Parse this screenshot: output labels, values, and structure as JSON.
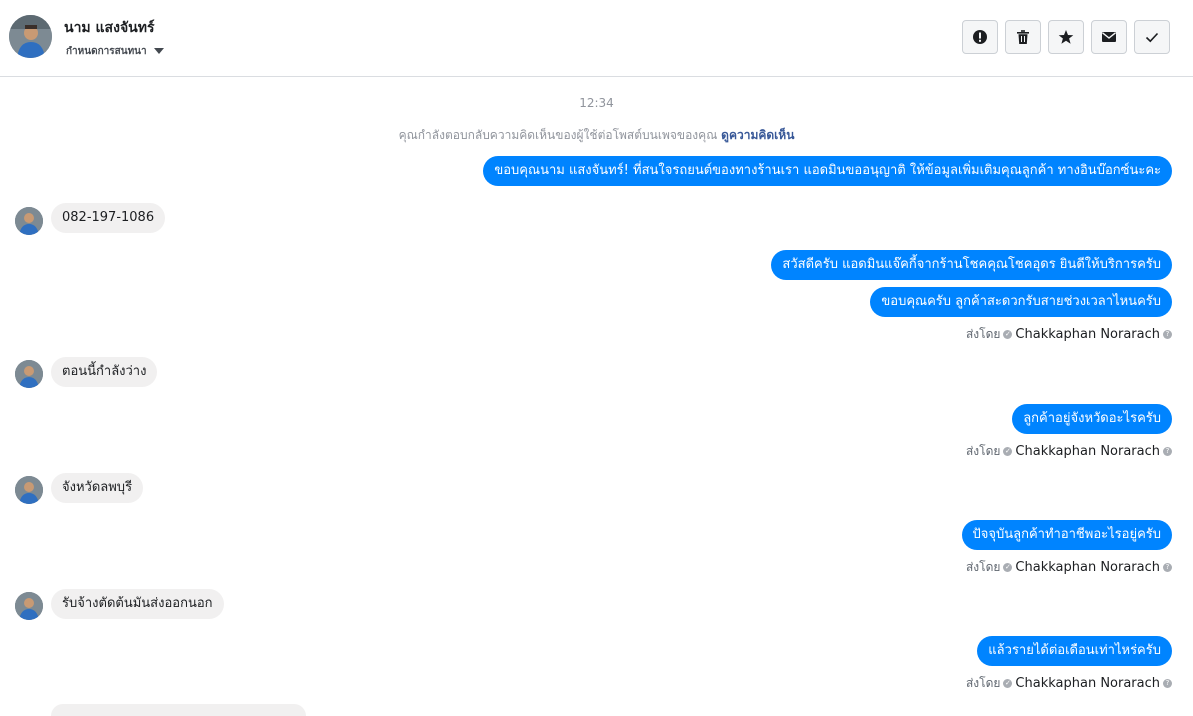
{
  "header": {
    "name": "นาม แสงจันทร์",
    "subtitle": "กำหนดการสนทนา",
    "buttons": [
      {
        "name": "report-button",
        "icon": "exclamation-icon"
      },
      {
        "name": "delete-button",
        "icon": "trash-icon"
      },
      {
        "name": "star-button",
        "icon": "star-icon"
      },
      {
        "name": "mark-unread-button",
        "icon": "envelope-icon"
      },
      {
        "name": "mark-done-button",
        "icon": "check-icon"
      }
    ]
  },
  "conversation": {
    "timestamp": "12:34",
    "reply_note": "คุณกำลังตอบกลับความคิดเห็นของผู้ใช้ต่อโพสต์บนเพจของคุณ",
    "reply_link": "ดูความคิดเห็น",
    "sent_by_label": "ส่งโดย",
    "agent_name": "Chakkaphan Norarach",
    "messages": [
      {
        "from": "page",
        "text": "ขอบคุณนาม แสงจันทร์! ที่สนใจรถยนต์ของทางร้านเรา แอดมินขออนุญาติ ให้ข้อมูลเพิ่มเติมคุณลูกค้า ทางอินบ๊อกซ์นะคะ"
      },
      {
        "from": "user",
        "text": "082-197-1086"
      },
      {
        "from": "page",
        "text": "สวัสดีครับ แอดมินแจ๊คกี้จากร้านโชคคุณโชคอุดร ยินดีให้บริการครับ"
      },
      {
        "from": "page",
        "text": "ขอบคุณครับ ลูกค้าสะดวกรับสายช่วงเวลาไหนครับ"
      },
      {
        "from": "user",
        "text": "ตอนนี้กำลังว่าง"
      },
      {
        "from": "page",
        "text": "ลูกค้าอยู่จังหวัดอะไรครับ"
      },
      {
        "from": "user",
        "text": "จังหวัดลพบุรี"
      },
      {
        "from": "page",
        "text": "ปัจจุบันลูกค้าทำอาชีพอะไรอยู่ครับ"
      },
      {
        "from": "user",
        "text": "รับจ้างตัดต้นมันส่งออกนอก"
      },
      {
        "from": "page",
        "text": "แล้วรายได้ต่อเดือนเท่าไหร่ครับ"
      }
    ]
  },
  "colors": {
    "outgoing_bubble": "#0084ff",
    "incoming_bubble": "#f1f0f0",
    "link": "#385898"
  }
}
